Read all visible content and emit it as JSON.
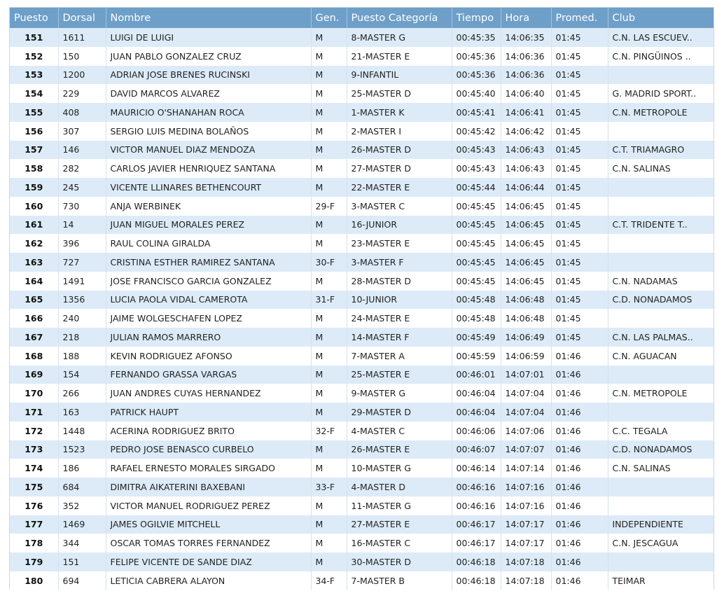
{
  "table": {
    "headers": [
      "Puesto",
      "Dorsal",
      "Nombre",
      "Gen.",
      "Puesto Categoría",
      "Tiempo",
      "Hora",
      "Promed.",
      "Club"
    ],
    "rows": [
      [
        "151",
        "1611",
        "LUIGI DE LUIGI",
        "M",
        "8-MASTER G",
        "00:45:35",
        "14:06:35",
        "01:45",
        "C.N. LAS ESCUEV.."
      ],
      [
        "152",
        "150",
        "JUAN PABLO GONZALEZ CRUZ",
        "M",
        "21-MASTER E",
        "00:45:36",
        "14:06:36",
        "01:45",
        "C.N. PINGÜINOS .."
      ],
      [
        "153",
        "1200",
        "ADRIAN JOSE BRENES RUCINSKI",
        "M",
        "9-INFANTIL",
        "00:45:36",
        "14:06:36",
        "01:45",
        ""
      ],
      [
        "154",
        "229",
        "DAVID MARCOS ALVAREZ",
        "M",
        "25-MASTER D",
        "00:45:40",
        "14:06:40",
        "01:45",
        "G. MADRID SPORT.."
      ],
      [
        "155",
        "408",
        "MAURICIO O'SHANAHAN ROCA",
        "M",
        "1-MASTER K",
        "00:45:41",
        "14:06:41",
        "01:45",
        "C.N. METROPOLE"
      ],
      [
        "156",
        "307",
        "SERGIO LUIS MEDINA BOLAÑOS",
        "M",
        "2-MASTER I",
        "00:45:42",
        "14:06:42",
        "01:45",
        ""
      ],
      [
        "157",
        "146",
        "VICTOR MANUEL DIAZ MENDOZA",
        "M",
        "26-MASTER D",
        "00:45:43",
        "14:06:43",
        "01:45",
        "C.T. TRIAMAGRO"
      ],
      [
        "158",
        "282",
        "CARLOS JAVIER HENRIQUEZ SANTANA",
        "M",
        "27-MASTER D",
        "00:45:43",
        "14:06:43",
        "01:45",
        "C.N. SALINAS"
      ],
      [
        "159",
        "245",
        "VICENTE LLINARES BETHENCOURT",
        "M",
        "22-MASTER E",
        "00:45:44",
        "14:06:44",
        "01:45",
        ""
      ],
      [
        "160",
        "730",
        "ANJA WERBINEK",
        "29-F",
        "3-MASTER C",
        "00:45:45",
        "14:06:45",
        "01:45",
        ""
      ],
      [
        "161",
        "14",
        "JUAN MIGUEL MORALES PEREZ",
        "M",
        "16-JUNIOR",
        "00:45:45",
        "14:06:45",
        "01:45",
        "C.T. TRIDENTE T.."
      ],
      [
        "162",
        "396",
        "RAUL COLINA GIRALDA",
        "M",
        "23-MASTER E",
        "00:45:45",
        "14:06:45",
        "01:45",
        ""
      ],
      [
        "163",
        "727",
        "CRISTINA ESTHER RAMIREZ SANTANA",
        "30-F",
        "3-MASTER F",
        "00:45:45",
        "14:06:45",
        "01:45",
        ""
      ],
      [
        "164",
        "1491",
        "JOSE FRANCISCO GARCIA GONZALEZ",
        "M",
        "28-MASTER D",
        "00:45:45",
        "14:06:45",
        "01:45",
        "C.N. NADAMAS"
      ],
      [
        "165",
        "1356",
        "LUCIA PAOLA VIDAL CAMEROTA",
        "31-F",
        "10-JUNIOR",
        "00:45:48",
        "14:06:48",
        "01:45",
        "C.D. NONADAMOS"
      ],
      [
        "166",
        "240",
        "JAIME WOLGESCHAFEN LOPEZ",
        "M",
        "24-MASTER E",
        "00:45:48",
        "14:06:48",
        "01:45",
        ""
      ],
      [
        "167",
        "218",
        "JULIAN RAMOS MARRERO",
        "M",
        "14-MASTER F",
        "00:45:49",
        "14:06:49",
        "01:45",
        "C.N. LAS PALMAS.."
      ],
      [
        "168",
        "188",
        "KEVIN RODRIGUEZ AFONSO",
        "M",
        "7-MASTER A",
        "00:45:59",
        "14:06:59",
        "01:46",
        "C.N. AGUACAN"
      ],
      [
        "169",
        "154",
        "FERNANDO GRASSA VARGAS",
        "M",
        "25-MASTER E",
        "00:46:01",
        "14:07:01",
        "01:46",
        ""
      ],
      [
        "170",
        "266",
        "JUAN ANDRES CUYAS HERNANDEZ",
        "M",
        "9-MASTER G",
        "00:46:04",
        "14:07:04",
        "01:46",
        "C.N. METROPOLE"
      ],
      [
        "171",
        "163",
        "PATRICK HAUPT",
        "M",
        "29-MASTER D",
        "00:46:04",
        "14:07:04",
        "01:46",
        ""
      ],
      [
        "172",
        "1448",
        "ACERINA RODRIGUEZ BRITO",
        "32-F",
        "4-MASTER C",
        "00:46:06",
        "14:07:06",
        "01:46",
        "C.C. TEGALA"
      ],
      [
        "173",
        "1523",
        "PEDRO JOSE BENASCO CURBELO",
        "M",
        "26-MASTER E",
        "00:46:07",
        "14:07:07",
        "01:46",
        "C.D. NONADAMOS"
      ],
      [
        "174",
        "186",
        "RAFAEL ERNESTO MORALES SIRGADO",
        "M",
        "10-MASTER G",
        "00:46:14",
        "14:07:14",
        "01:46",
        "C.N. SALINAS"
      ],
      [
        "175",
        "684",
        "DIMITRA AIKATERINI BAXEBANI",
        "33-F",
        "4-MASTER D",
        "00:46:16",
        "14:07:16",
        "01:46",
        ""
      ],
      [
        "176",
        "352",
        "VICTOR MANUEL RODRIGUEZ PEREZ",
        "M",
        "11-MASTER G",
        "00:46:16",
        "14:07:16",
        "01:46",
        ""
      ],
      [
        "177",
        "1469",
        "JAMES OGILVIE MITCHELL",
        "M",
        "27-MASTER E",
        "00:46:17",
        "14:07:17",
        "01:46",
        "INDEPENDIENTE"
      ],
      [
        "178",
        "344",
        "OSCAR TOMAS TORRES FERNANDEZ",
        "M",
        "16-MASTER C",
        "00:46:17",
        "14:07:17",
        "01:46",
        "C.N. JESCAGUA"
      ],
      [
        "179",
        "151",
        "FELIPE VICENTE DE SANDE DIAZ",
        "M",
        "30-MASTER D",
        "00:46:18",
        "14:07:18",
        "01:46",
        ""
      ],
      [
        "180",
        "694",
        "LETICIA CABRERA ALAYON",
        "34-F",
        "7-MASTER B",
        "00:46:18",
        "14:07:18",
        "01:46",
        "TEIMAR"
      ]
    ]
  },
  "colors": {
    "header_bg": "#6e9fc9",
    "row_alt": "#dcebf7",
    "row_base": "#ffffff"
  }
}
